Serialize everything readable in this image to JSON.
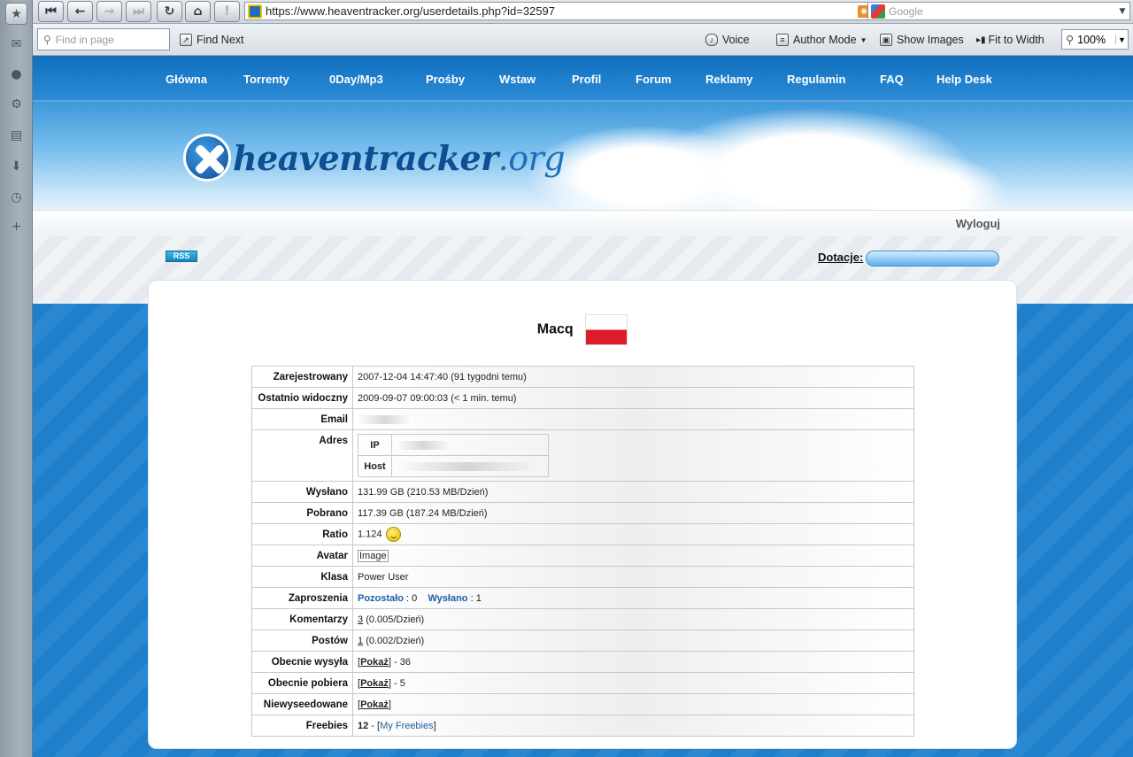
{
  "browser": {
    "url": "https://www.heaventracker.org/userdetails.php?id=32597",
    "search_placeholder": "Google",
    "find_placeholder": "Find in page",
    "find_next_label": "Find Next",
    "voice_label": "Voice",
    "author_mode_label": "Author Mode",
    "show_images_label": "Show Images",
    "fit_to_width_label": "Fit to Width",
    "zoom": "100%"
  },
  "site": {
    "menu": [
      "Główna",
      "Torrenty",
      "0Day/Mp3",
      "Prośby",
      "Wstaw",
      "Profil",
      "Forum",
      "Reklamy",
      "Regulamin",
      "FAQ",
      "Help Desk"
    ],
    "logo_name": "heaventracker",
    "logo_tld": ".org",
    "logout_label": "Wyloguj",
    "rss_label": "RSS",
    "donate_label": "Dotacje:"
  },
  "profile": {
    "username": "Macq",
    "registered_label": "Zarejestrowany",
    "registered_value": "2007-12-04 14:47:40 (91 tygodni temu)",
    "last_seen_label": "Ostatnio widoczny",
    "last_seen_value": "2009-09-07 09:00:03 (< 1 min. temu)",
    "email_label": "Email",
    "address_label": "Adres",
    "ip_label": "IP",
    "host_label": "Host",
    "uploaded_label": "Wysłano",
    "uploaded_value": "131.99 GB (210.53 MB/Dzień)",
    "downloaded_label": "Pobrano",
    "downloaded_value": "117.39 GB (187.24 MB/Dzień)",
    "ratio_label": "Ratio",
    "ratio_value": "1.124",
    "avatar_label": "Avatar",
    "avatar_value": "Image",
    "class_label": "Klasa",
    "class_value": "Power User",
    "invites_label": "Zaproszenia",
    "invites_left_label": "Pozostało",
    "invites_left_value": ": 0",
    "invites_sent_label": "Wysłano",
    "invites_sent_value": ": 1",
    "comments_label": "Komentarzy",
    "comments_count": "3",
    "comments_rate": "(0.005/Dzień)",
    "posts_label": "Postów",
    "posts_count": "1",
    "posts_rate": "(0.002/Dzień)",
    "seeding_label": "Obecnie wysyła",
    "seeding_value": "- 36",
    "leeching_label": "Obecnie pobiera",
    "leeching_value": "- 5",
    "unseeded_label": "Niewyseedowane",
    "show_link": "Pokaż",
    "freebies_label": "Freebies",
    "freebies_count": "12",
    "freebies_link": "My Freebies"
  }
}
